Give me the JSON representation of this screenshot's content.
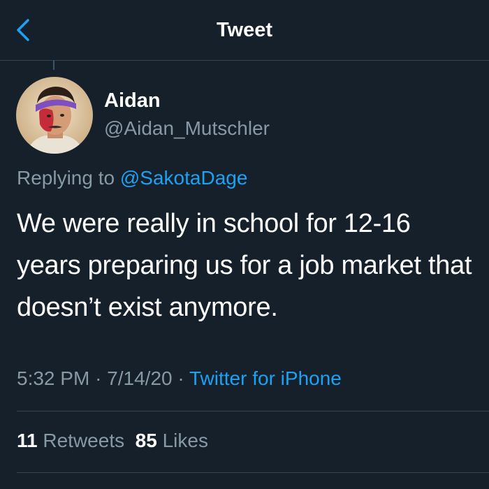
{
  "colors": {
    "background": "#15202b",
    "text_primary": "#ffffff",
    "text_secondary": "#8899a6",
    "link": "#1da1f2",
    "divider": "#38444d"
  },
  "nav": {
    "back_icon": "chevron-left-icon",
    "title": "Tweet"
  },
  "author": {
    "name": "Aidan",
    "handle": "@Aidan_Mutschler"
  },
  "reply": {
    "prefix": "Replying to",
    "mention": "@SakotaDage"
  },
  "tweet": {
    "text": "We were really in school for 12-16 years preparing us for a job market that doesn’t exist anymore."
  },
  "meta": {
    "time": "5:32 PM",
    "date": "7/14/20",
    "separator": "·",
    "source": "Twitter for iPhone"
  },
  "stats": {
    "retweets_count": "11",
    "retweets_label": "Retweets",
    "likes_count": "85",
    "likes_label": "Likes"
  }
}
